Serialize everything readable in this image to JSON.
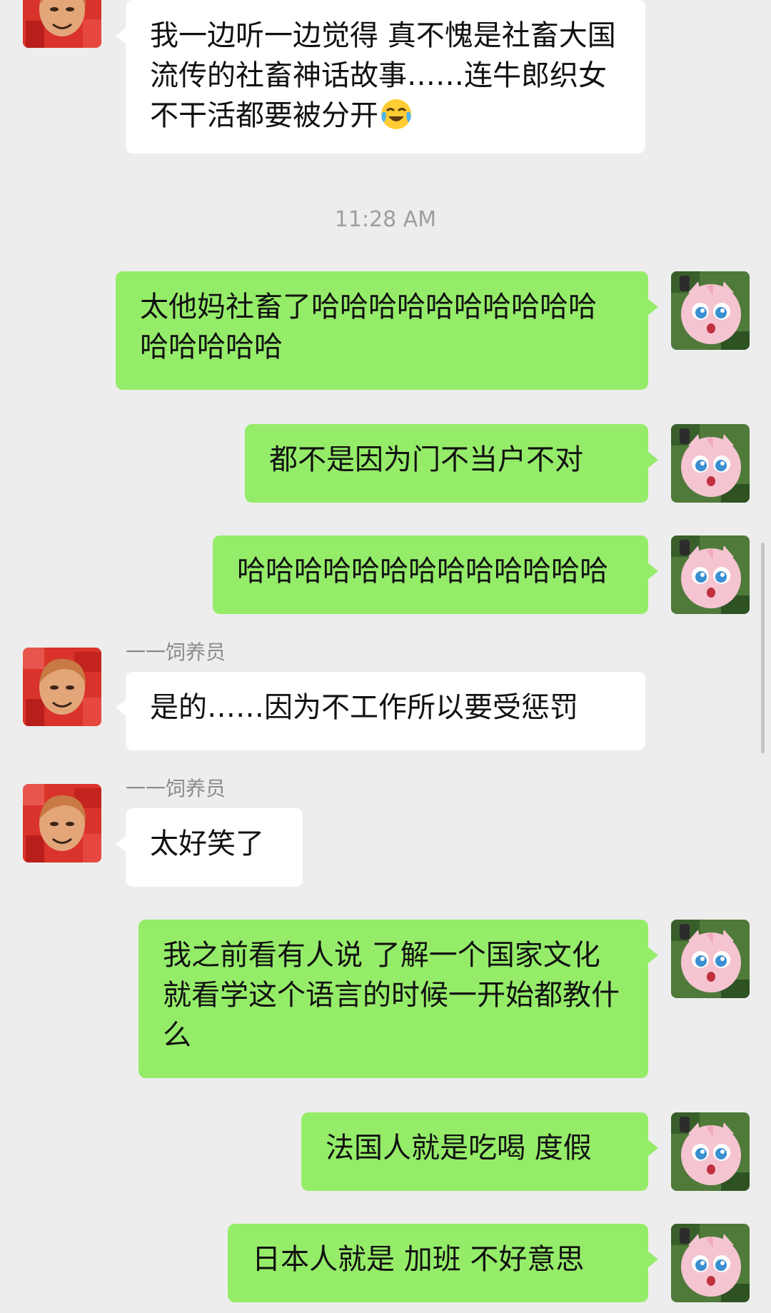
{
  "timestamp": "11:28 AM",
  "contact_name": "一一饲养员",
  "messages": [
    {
      "side": "left",
      "text": "我一边听一边觉得 真不愧是社畜大国流传的社畜神话故事……连牛郎织女不干活都要被分开",
      "emoji": "tears-of-joy-icon"
    },
    {
      "side": "right",
      "text": "太他妈社畜了哈哈哈哈哈哈哈哈哈哈哈哈哈哈哈"
    },
    {
      "side": "right",
      "text": "都不是因为门不当户不对"
    },
    {
      "side": "right",
      "text": "哈哈哈哈哈哈哈哈哈哈哈哈哈"
    },
    {
      "side": "left",
      "text": "是的……因为不工作所以要受惩罚"
    },
    {
      "side": "left",
      "text": "太好笑了"
    },
    {
      "side": "right",
      "text": "我之前看有人说 了解一个国家文化 就看学这个语言的时候一开始都教什么"
    },
    {
      "side": "right",
      "text": "法国人就是吃喝 度假"
    },
    {
      "side": "right",
      "text": "日本人就是 加班 不好意思"
    }
  ],
  "colors": {
    "background": "#ededed",
    "bubble_self": "#95ec69",
    "bubble_other": "#ffffff",
    "name_text": "#8b8b8b",
    "timestamp_text": "#9e9e9e"
  }
}
